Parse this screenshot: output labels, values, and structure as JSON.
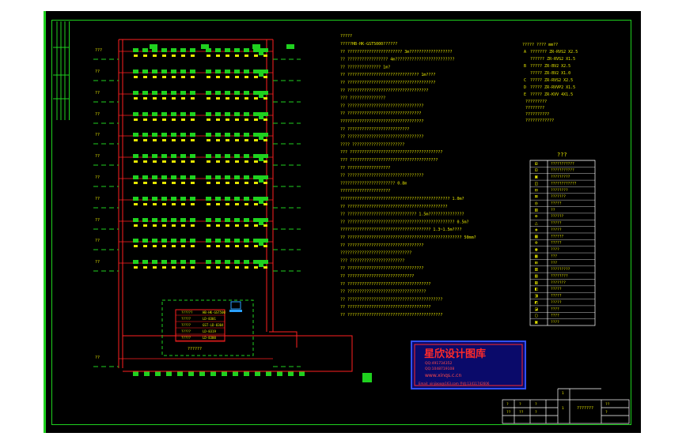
{
  "system_diagram": {
    "floor_labels": [
      "???",
      "??",
      "??",
      "??",
      "??",
      "??",
      "??",
      "??",
      "??",
      "??",
      "??",
      "??"
    ],
    "panel_box_label": "??????",
    "device_rows": [
      {
        "name": "??????",
        "code": "HB-HK-GST500"
      },
      {
        "name": "?????",
        "code": "LD-8301"
      },
      {
        "name": "?????",
        "code": "GST-LD-8304"
      },
      {
        "name": "?????",
        "code": "LD-8319"
      },
      {
        "name": "?????",
        "code": "LD-8300"
      }
    ]
  },
  "notes": {
    "title": "?????",
    "lines": [
      "?????HB-HK-GST5000??????",
      "??  ??????????????????????? 3m??????????????????",
      "??  ????????????????? 4m?????????????????????????",
      "?? ?????????????? 1m?",
      "??  ?????????????????????????????? 1m????",
      "?? ?????????????????????????????????????",
      "?? ??????????????????????????????????",
      "??? ???????????????",
      "?? ????????????????????????????????",
      "?? ???????????????????????????????",
      "???????????????????????????????????",
      "?? ??????????????????????????",
      "?? ????????????????????????????????",
      "???? ??????????????????????",
      "??? ???????????????????????????????????????",
      "??? ?????????????????????????????????????",
      "?? ??????????????????",
      "?? ????????????????????????????????",
      "??????????????????????? 0.8m",
      "?????????????????????",
      "?????????????????????????????????????????????? 1.0m?",
      "?? ??????????????????????????????????????????",
      "?? ????????????????????????????? 1.5m???????????????",
      "?? ????????????????????????????????????????????? 0.5m?",
      "?????????????????????????????????????? 1.3~1.5m????",
      "?? ???????????????????????????????????????????????? 50mm?",
      "?? ????????????????????????????????",
      "??????????????????????????????",
      "??? ???????????????????????",
      "?? ????????????????????????????????",
      "?? ????????????????????????????",
      "?? ???????????????????????????????????",
      "?? ?????????????????????????????????",
      "?? ????????????????????????????????????????",
      "?? ???????????????????????????????????",
      "?? ????????????????????????????????????????"
    ]
  },
  "cable_specs": {
    "header": "?????    ???? mm??",
    "rows": [
      {
        "code": "A",
        "text": "??????? ZR-RVS2 X2.5"
      },
      {
        "code": "",
        "text": "?????? ZR-RVS2 X1.5"
      },
      {
        "code": "B",
        "text": "????? ZR-BV2 X2.5"
      },
      {
        "code": "",
        "text": "????? ZR-BV2 X1.0"
      },
      {
        "code": "C",
        "text": "????? ZR-RVS2 X2.5"
      },
      {
        "code": "D",
        "text": "????? ZR-RVVP2 X1.5"
      },
      {
        "code": "E",
        "text": "????? ZR-KVV 4X1.5"
      }
    ],
    "extra_notes": [
      "?????????",
      "????????",
      "??????????",
      "????????????"
    ]
  },
  "legend": {
    "title": "???",
    "items": [
      {
        "symbol": "⊞",
        "label": "???????????"
      },
      {
        "symbol": "⊡",
        "label": "???????????"
      },
      {
        "symbol": "▣",
        "label": "?????????"
      },
      {
        "symbol": "◫",
        "label": "????????????"
      },
      {
        "symbol": "⊟",
        "label": "????????"
      },
      {
        "symbol": "⊠",
        "label": "???????"
      },
      {
        "symbol": "◎",
        "label": "?????"
      },
      {
        "symbol": "▤",
        "label": "??"
      },
      {
        "symbol": "⊕",
        "label": "??????"
      },
      {
        "symbol": "△",
        "label": "?????"
      },
      {
        "symbol": "◈",
        "label": "?????"
      },
      {
        "symbol": "▦",
        "label": "??????"
      },
      {
        "symbol": "⊗",
        "label": "?????"
      },
      {
        "symbol": "◉",
        "label": "????"
      },
      {
        "symbol": "▩",
        "label": "???"
      },
      {
        "symbol": "⊞",
        "label": "???"
      },
      {
        "symbol": "▥",
        "label": "?????????"
      },
      {
        "symbol": "▧",
        "label": "????????"
      },
      {
        "symbol": "▨",
        "label": "???????"
      },
      {
        "symbol": "◧",
        "label": "?????"
      },
      {
        "symbol": "◨",
        "label": "?????"
      },
      {
        "symbol": "◩",
        "label": "?????"
      },
      {
        "symbol": "◪",
        "label": "????"
      },
      {
        "symbol": "▢",
        "label": "????"
      },
      {
        "symbol": "▣",
        "label": "????"
      }
    ]
  },
  "watermark": {
    "title": "星欣设计图库",
    "qq1": "QQ:491734352",
    "qq2": "QQ:1048719108",
    "site": "www.xinqs.c.cn",
    "footer": "Email: xinjiaoo@163.com 手机:13411742606"
  },
  "title_block": {
    "drawing_name": "???????",
    "cells": [
      "?",
      "?",
      "?",
      "??",
      "??",
      "?",
      "1",
      "1",
      "??",
      "?"
    ]
  }
}
